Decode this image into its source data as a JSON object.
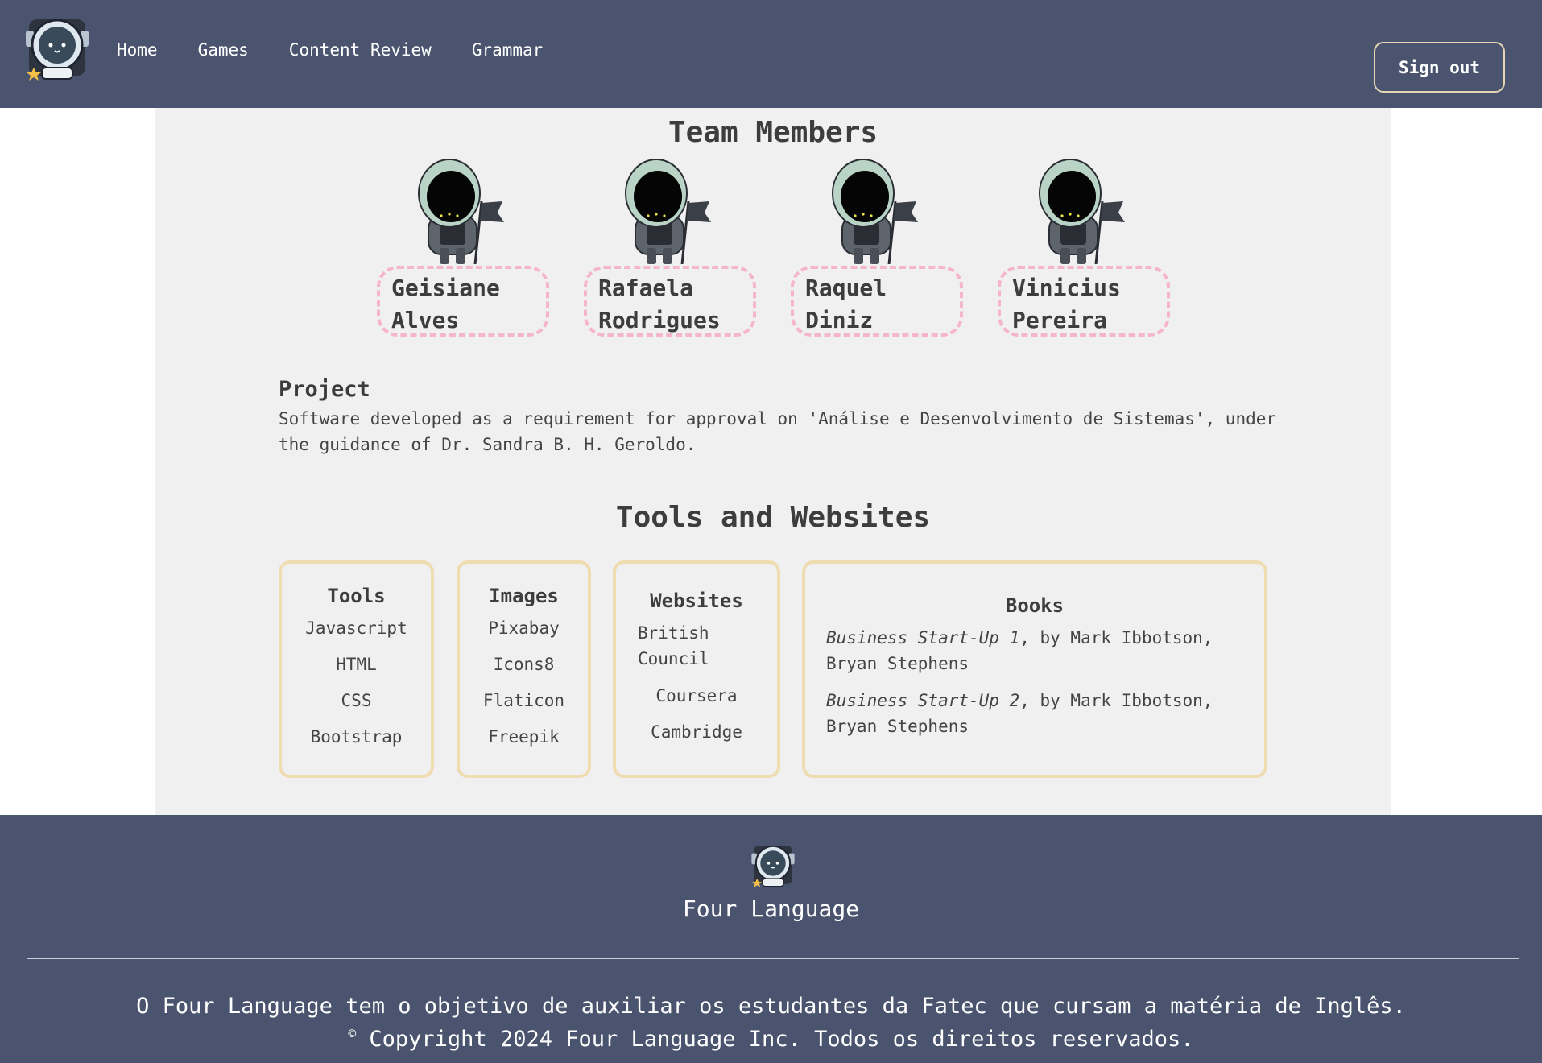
{
  "nav": {
    "links": [
      "Home",
      "Games",
      "Content Review",
      "Grammar"
    ],
    "signout_label": "Sign out"
  },
  "team": {
    "title": "Team Members",
    "members": [
      {
        "first": "Geisiane",
        "last": "Alves"
      },
      {
        "first": "Rafaela",
        "last": "Rodrigues"
      },
      {
        "first": "Raquel",
        "last": "Diniz"
      },
      {
        "first": "Vinicius",
        "last": "Pereira"
      }
    ]
  },
  "project": {
    "heading": "Project",
    "text": "Software developed as a requirement for approval on 'Análise e Desenvolvimento de Sistemas', under the guidance of Dr. Sandra B. H. Geroldo."
  },
  "tools_section": {
    "title": "Tools and Websites",
    "tools": {
      "title": "Tools",
      "items": [
        "Javascript",
        "HTML",
        "CSS",
        "Bootstrap"
      ]
    },
    "images": {
      "title": "Images",
      "items": [
        "Pixabay",
        "Icons8",
        "Flaticon",
        "Freepik"
      ]
    },
    "websites": {
      "title": "Websites",
      "items": [
        "British Council",
        "Coursera",
        "Cambridge"
      ]
    },
    "books": {
      "title": "Books",
      "items": [
        {
          "title": "Business Start-Up 1",
          "rest": ", by Mark Ibbotson, Bryan Stephens"
        },
        {
          "title": "Business Start-Up 2",
          "rest": ", by Mark Ibbotson, Bryan Stephens"
        }
      ]
    }
  },
  "footer": {
    "brand": "Four Language",
    "description": "O Four Language tem o objetivo de auxiliar os estudantes da Fatec que cursam a matéria de Inglês.",
    "copyright_symbol": "©",
    "copyright": " Copyright 2024 Four Language Inc. Todos os direitos reservados."
  },
  "colors": {
    "navbar": "#4a546e",
    "panel": "#f0f0f0",
    "name_border": "#f5b6c8",
    "card_border": "#efdcb0",
    "button_border": "#e6d6b3"
  }
}
